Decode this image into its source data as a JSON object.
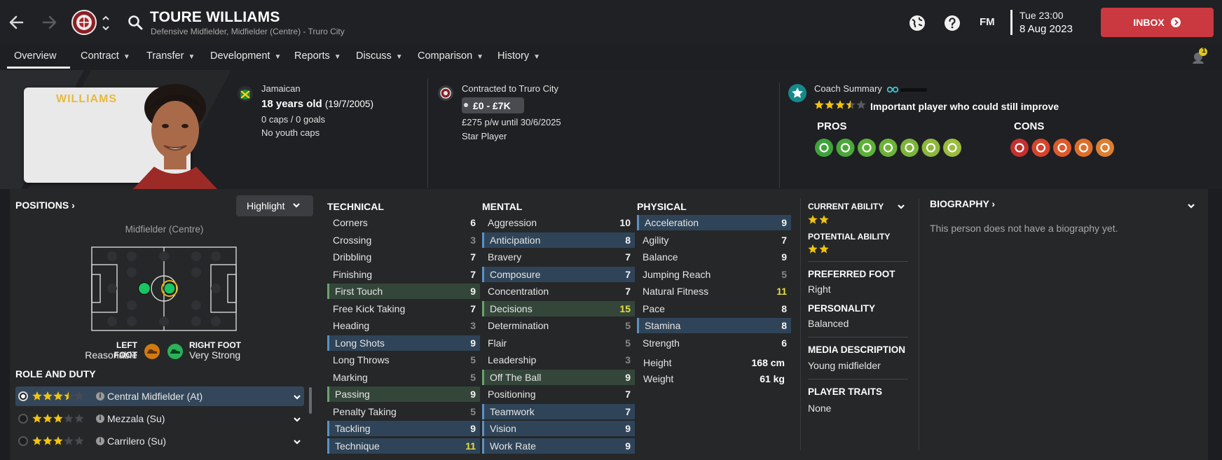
{
  "header": {
    "name": "TOURE WILLIAMS",
    "subtitle": "Defensive Midfielder, Midfielder (Centre) - Truro City",
    "date_line1": "Tue 23:00",
    "date_line2": "8 Aug 2023",
    "fm_label": "FM",
    "inbox_label": "INBOX",
    "notification_count": "1"
  },
  "tabs": [
    {
      "label": "Overview"
    },
    {
      "label": "Contract"
    },
    {
      "label": "Transfer"
    },
    {
      "label": "Development"
    },
    {
      "label": "Reports"
    },
    {
      "label": "Discuss"
    },
    {
      "label": "Comparison"
    },
    {
      "label": "History"
    }
  ],
  "profile": {
    "shirt_name": "WILLIAMS",
    "nationality": "Jamaican",
    "age": "18 years old",
    "dob": "(19/7/2005)",
    "caps": "0 caps / 0 goals",
    "youth_caps": "No youth caps",
    "contract_club": "Contracted to Truro City",
    "value_range": "£0 - £7K",
    "wage": "£275 p/w until 30/6/2025",
    "squad_status": "Star Player"
  },
  "coach": {
    "title": "Coach Summary",
    "stars": 3.5,
    "summary": "Important player who could still improve",
    "pros_label": "PROS",
    "cons_label": "CONS",
    "pros_colors": [
      "#3fa33a",
      "#4aa83a",
      "#5db038",
      "#6cb238",
      "#7cb43a",
      "#8db83c",
      "#9cbc3e"
    ],
    "cons_colors": [
      "#c4302e",
      "#d4452c",
      "#dc5a2c",
      "#dd6e2c",
      "#dd7e30"
    ]
  },
  "positions": {
    "title": "POSITIONS",
    "highlight_label": "Highlight",
    "position_name": "Midfielder (Centre)",
    "left_foot_label": "LEFT FOOT",
    "left_foot_value": "Reasonable",
    "right_foot_label": "RIGHT FOOT",
    "right_foot_value": "Very Strong"
  },
  "roles": {
    "title": "ROLE AND DUTY",
    "items": [
      {
        "name": "Central Midfielder (At)",
        "stars": 3.5
      },
      {
        "name": "Mezzala (Su)",
        "stars": 3
      },
      {
        "name": "Carrilero (Su)",
        "stars": 3
      }
    ]
  },
  "technical": {
    "title": "TECHNICAL",
    "items": [
      {
        "name": "Corners",
        "value": "6"
      },
      {
        "name": "Crossing",
        "value": "3"
      },
      {
        "name": "Dribbling",
        "value": "7"
      },
      {
        "name": "Finishing",
        "value": "7"
      },
      {
        "name": "First Touch",
        "value": "9"
      },
      {
        "name": "Free Kick Taking",
        "value": "7"
      },
      {
        "name": "Heading",
        "value": "3"
      },
      {
        "name": "Long Shots",
        "value": "9"
      },
      {
        "name": "Long Throws",
        "value": "5"
      },
      {
        "name": "Marking",
        "value": "5"
      },
      {
        "name": "Passing",
        "value": "9"
      },
      {
        "name": "Penalty Taking",
        "value": "5"
      },
      {
        "name": "Tackling",
        "value": "9"
      },
      {
        "name": "Technique",
        "value": "11"
      }
    ]
  },
  "mental": {
    "title": "MENTAL",
    "items": [
      {
        "name": "Aggression",
        "value": "10"
      },
      {
        "name": "Anticipation",
        "value": "8"
      },
      {
        "name": "Bravery",
        "value": "7"
      },
      {
        "name": "Composure",
        "value": "7"
      },
      {
        "name": "Concentration",
        "value": "7"
      },
      {
        "name": "Decisions",
        "value": "15"
      },
      {
        "name": "Determination",
        "value": "5"
      },
      {
        "name": "Flair",
        "value": "5"
      },
      {
        "name": "Leadership",
        "value": "3"
      },
      {
        "name": "Off The Ball",
        "value": "9"
      },
      {
        "name": "Positioning",
        "value": "7"
      },
      {
        "name": "Teamwork",
        "value": "7"
      },
      {
        "name": "Vision",
        "value": "9"
      },
      {
        "name": "Work Rate",
        "value": "9"
      }
    ]
  },
  "physical": {
    "title": "PHYSICAL",
    "items": [
      {
        "name": "Acceleration",
        "value": "9"
      },
      {
        "name": "Agility",
        "value": "7"
      },
      {
        "name": "Balance",
        "value": "9"
      },
      {
        "name": "Jumping Reach",
        "value": "5"
      },
      {
        "name": "Natural Fitness",
        "value": "11"
      },
      {
        "name": "Pace",
        "value": "8"
      },
      {
        "name": "Stamina",
        "value": "8"
      },
      {
        "name": "Strength",
        "value": "6"
      }
    ],
    "height_label": "Height",
    "height_value": "168 cm",
    "weight_label": "Weight",
    "weight_value": "61 kg"
  },
  "side": {
    "current_ability_label": "CURRENT ABILITY",
    "current_ability_stars": 2,
    "potential_ability_label": "POTENTIAL ABILITY",
    "potential_ability_stars": 2,
    "preferred_foot_label": "PREFERRED FOOT",
    "preferred_foot_value": "Right",
    "personality_label": "PERSONALITY",
    "personality_value": "Balanced",
    "media_label": "MEDIA DESCRIPTION",
    "media_value": "Young midfielder",
    "traits_label": "PLAYER TRAITS",
    "traits_value": "None"
  },
  "biography": {
    "title": "BIOGRAPHY",
    "text": "This person does not have a biography yet."
  }
}
